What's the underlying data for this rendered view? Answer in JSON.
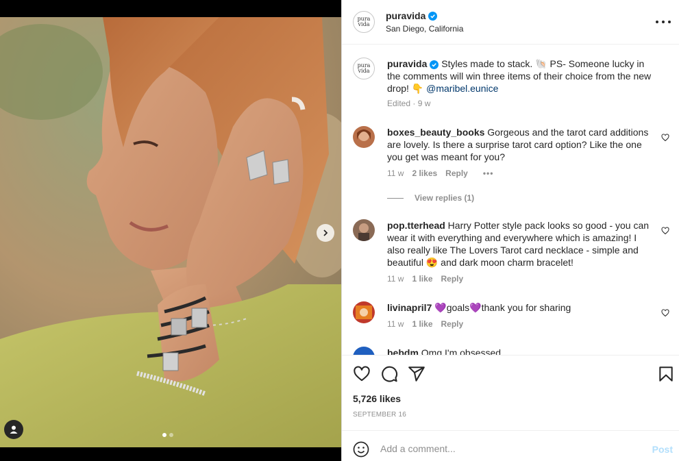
{
  "post": {
    "author": "puravida",
    "location": "San Diego, California",
    "avatar_text_top": "pura",
    "avatar_text_bottom": "vida"
  },
  "caption": {
    "username": "puravida",
    "text_before": " Styles made to stack. ",
    "emoji1": "🐚",
    "text_mid": " PS- Someone lucky in the comments will win three items of their choice from the new drop! ",
    "emoji2": "👇",
    "mention": "@maribel.eunice",
    "meta": "Edited · 9 w"
  },
  "comments": [
    {
      "username": "boxes_beauty_books",
      "text": " Gorgeous and the tarot card additions are lovely. Is there a surprise tarot card option? Like the one you get was meant for you?",
      "time": "11 w",
      "likes": "2 likes",
      "reply": "Reply",
      "more": "•••"
    },
    {
      "username": "pop.tterhead",
      "text": " Harry Potter style pack looks so good - you can wear it with everything and everywhere which is amazing! I also really like The Lovers Tarot card necklace - simple and beautiful ",
      "emoji": "😍",
      "text_after": " and dark moon charm bracelet!",
      "time": "11 w",
      "likes": "1 like",
      "reply": "Reply"
    },
    {
      "username": "livinapril7",
      "emoji": "💜",
      "text": "goals",
      "emoji2": "💜",
      "text_after": "thank you for sharing",
      "time": "11 w",
      "likes": "1 like",
      "reply": "Reply"
    },
    {
      "username": "bebdm",
      "text": " Omg I'm obsessed"
    }
  ],
  "view_replies": "View replies (1)",
  "likes": "5,726 likes",
  "date": "SEPTEMBER 16",
  "comment_input": {
    "placeholder": "Add a comment..."
  },
  "post_button": "Post",
  "colors": {
    "accent": "#0095f6",
    "link": "#00376b",
    "muted": "#8e8e8e",
    "post_disabled": "#b2dffc"
  },
  "icons": [
    "more-icon",
    "verified-icon",
    "heart-icon",
    "comment-icon",
    "share-icon",
    "bookmark-icon",
    "emoji-icon",
    "chevron-right-icon",
    "user-tag-icon"
  ]
}
